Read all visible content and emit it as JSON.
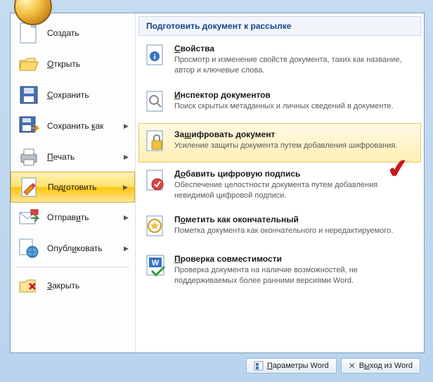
{
  "left_menu": {
    "items": [
      {
        "label": "Создать",
        "accel_index": -1,
        "has_arrow": false
      },
      {
        "label": "Открыть",
        "accel_index": 0,
        "has_arrow": false
      },
      {
        "label": "Сохранить",
        "accel_index": 0,
        "has_arrow": false
      },
      {
        "label": "Сохранить как",
        "accel_index": 10,
        "has_arrow": true
      },
      {
        "label": "Печать",
        "accel_index": 0,
        "has_arrow": true
      },
      {
        "label": "Подготовить",
        "accel_index": 3,
        "has_arrow": true,
        "selected": true
      },
      {
        "label": "Отправить",
        "accel_index": 6,
        "has_arrow": true
      },
      {
        "label": "Опубликовать",
        "accel_index": 5,
        "has_arrow": true
      },
      {
        "label": "Закрыть",
        "accel_index": 0,
        "has_arrow": false
      }
    ]
  },
  "right_panel": {
    "header": "Подготовить документ к рассылке",
    "items": [
      {
        "title": "Свойства",
        "accel_index": 0,
        "desc": "Просмотр и изменение свойств документа, таких как название, автор и ключевые слова."
      },
      {
        "title": "Инспектор документов",
        "accel_index": 0,
        "desc": "Поиск скрытых метаданных и личных сведений в документе."
      },
      {
        "title": "Зашифровать документ",
        "accel_index": 2,
        "desc": "Усиление защиты документа путем добавления шифрования.",
        "hover": true
      },
      {
        "title": "Добавить цифровую подпись",
        "accel_index": 1,
        "desc": "Обеспечение целостности документа путем добавления невидимой цифровой подписи."
      },
      {
        "title": "Пометить как окончательный",
        "accel_index": 1,
        "desc": "Пометка документа как окончательного и нередактируемого."
      },
      {
        "title": "Проверка совместимости",
        "accel_index": 0,
        "desc": "Проверка документа на наличие возможностей, не поддерживаемых более ранними версиями Word."
      }
    ]
  },
  "bottom": {
    "options_label": "Параметры Word",
    "options_accel": 0,
    "exit_label": "Выход из Word",
    "exit_accel": 1
  }
}
